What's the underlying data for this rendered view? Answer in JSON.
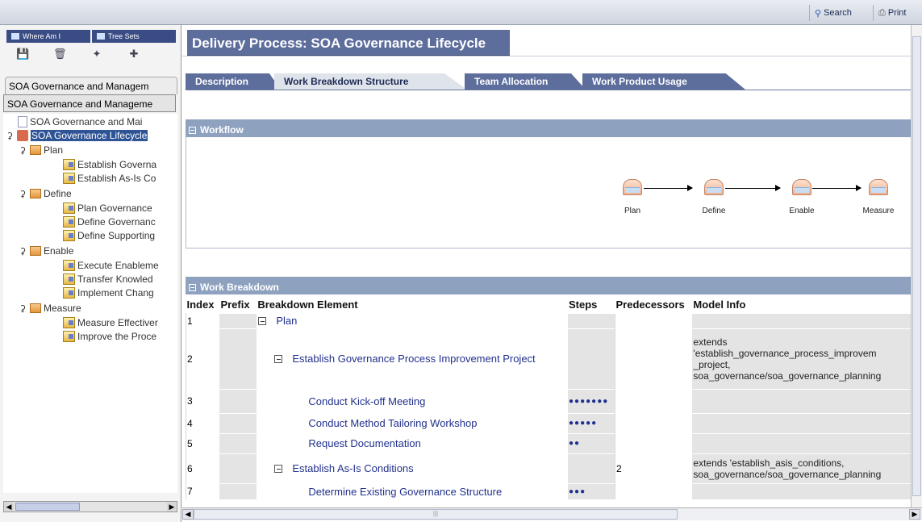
{
  "toolbar": {
    "search_label": "Search",
    "print_label": "Print"
  },
  "nav": {
    "tabs": [
      {
        "label": "Where Am I"
      },
      {
        "label": "Tree Sets"
      }
    ],
    "view_tab_1": "SOA Governance and Managem",
    "view_tab_2": "SOA Governance and Manageme"
  },
  "tree": {
    "root": "SOA Governance and Mai",
    "selected": "SOA Governance Lifecycle",
    "phases": [
      {
        "label": "Plan",
        "children": [
          "Establish Governa",
          "Establish As-Is Co"
        ]
      },
      {
        "label": "Define",
        "children": [
          "Plan Governance",
          "Define Governanc",
          "Define Supporting"
        ]
      },
      {
        "label": "Enable",
        "children": [
          "Execute Enableme",
          "Transfer Knowled",
          "Implement Chang"
        ]
      },
      {
        "label": "Measure",
        "children": [
          "Measure Effectiver",
          "Improve the Proce"
        ]
      }
    ]
  },
  "page": {
    "title": "Delivery Process: SOA Governance Lifecycle",
    "tabs": [
      {
        "label": "Description",
        "active": false
      },
      {
        "label": "Work Breakdown Structure",
        "active": true
      },
      {
        "label": "Team Allocation",
        "active": false
      },
      {
        "label": "Work Product Usage",
        "active": false
      }
    ]
  },
  "workflow": {
    "title": "Workflow",
    "nodes": [
      {
        "label": "Plan"
      },
      {
        "label": "Define"
      },
      {
        "label": "Enable"
      },
      {
        "label": "Measure"
      }
    ]
  },
  "work_breakdown": {
    "title": "Work Breakdown",
    "columns": [
      "Index",
      "Prefix",
      "Breakdown Element",
      "Steps",
      "Predecessors",
      "Model Info"
    ],
    "rows": [
      {
        "index": "1",
        "prefix": "",
        "element": "Plan",
        "level": 0,
        "expandable": true,
        "steps": "",
        "predecessors": "",
        "model_info": ""
      },
      {
        "index": "2",
        "prefix": "",
        "element": "Establish Governance Process Improvement Project",
        "level": 1,
        "expandable": true,
        "steps": "",
        "predecessors": "",
        "model_info": "extends\n'establish_governance_process_improvem\n_project,\nsoa_governance/soa_governance_planning"
      },
      {
        "index": "3",
        "prefix": "",
        "element": "Conduct Kick-off Meeting",
        "level": 2,
        "expandable": false,
        "steps": "●●●●●●●",
        "predecessors": "",
        "model_info": ""
      },
      {
        "index": "4",
        "prefix": "",
        "element": "Conduct Method Tailoring Workshop",
        "level": 2,
        "expandable": false,
        "steps": "●●●●●",
        "predecessors": "",
        "model_info": ""
      },
      {
        "index": "5",
        "prefix": "",
        "element": "Request Documentation",
        "level": 2,
        "expandable": false,
        "steps": "●●",
        "predecessors": "",
        "model_info": ""
      },
      {
        "index": "6",
        "prefix": "",
        "element": "Establish As-Is Conditions",
        "level": 1,
        "expandable": true,
        "steps": "",
        "predecessors": "2",
        "model_info": "extends 'establish_asis_conditions,\nsoa_governance/soa_governance_planning"
      },
      {
        "index": "7",
        "prefix": "",
        "element": "Determine Existing Governance Structure",
        "level": 2,
        "expandable": false,
        "steps": "●●●",
        "predecessors": "",
        "model_info": ""
      }
    ]
  }
}
